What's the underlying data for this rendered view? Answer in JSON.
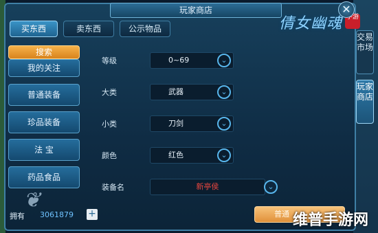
{
  "window": {
    "title": "玩家商店",
    "close_icon": "close-icon"
  },
  "logo": {
    "text": "倩女幽魂",
    "badge": "手游"
  },
  "top_tabs": [
    {
      "label": "买东西",
      "active": true
    },
    {
      "label": "卖东西",
      "active": false
    },
    {
      "label": "公示物品",
      "active": false
    }
  ],
  "sidebar": {
    "search": "搜索",
    "items": [
      {
        "label": "我的关注"
      },
      {
        "label": "普通装备"
      },
      {
        "label": "珍品装备"
      },
      {
        "label": "法 宝"
      },
      {
        "label": "药品食品"
      }
    ]
  },
  "form": {
    "rows": [
      {
        "label": "等级",
        "value": "0~69"
      },
      {
        "label": "大类",
        "value": "武器"
      },
      {
        "label": "小类",
        "value": "刀剑"
      },
      {
        "label": "颜色",
        "value": "红色"
      },
      {
        "label": "装备名",
        "value": "新亭侯"
      }
    ]
  },
  "right_tabs": [
    {
      "label": "交易市场",
      "active": false
    },
    {
      "label": "玩家商店",
      "active": true
    }
  ],
  "bottom": {
    "own_label": "拥有",
    "own_value": "3061879",
    "search_button": "普通",
    "watermark_right": "维普手游网"
  },
  "colors": {
    "accent": "#3a93c6",
    "orange": "#f6b24a",
    "highlight_red": "#e4453f"
  }
}
